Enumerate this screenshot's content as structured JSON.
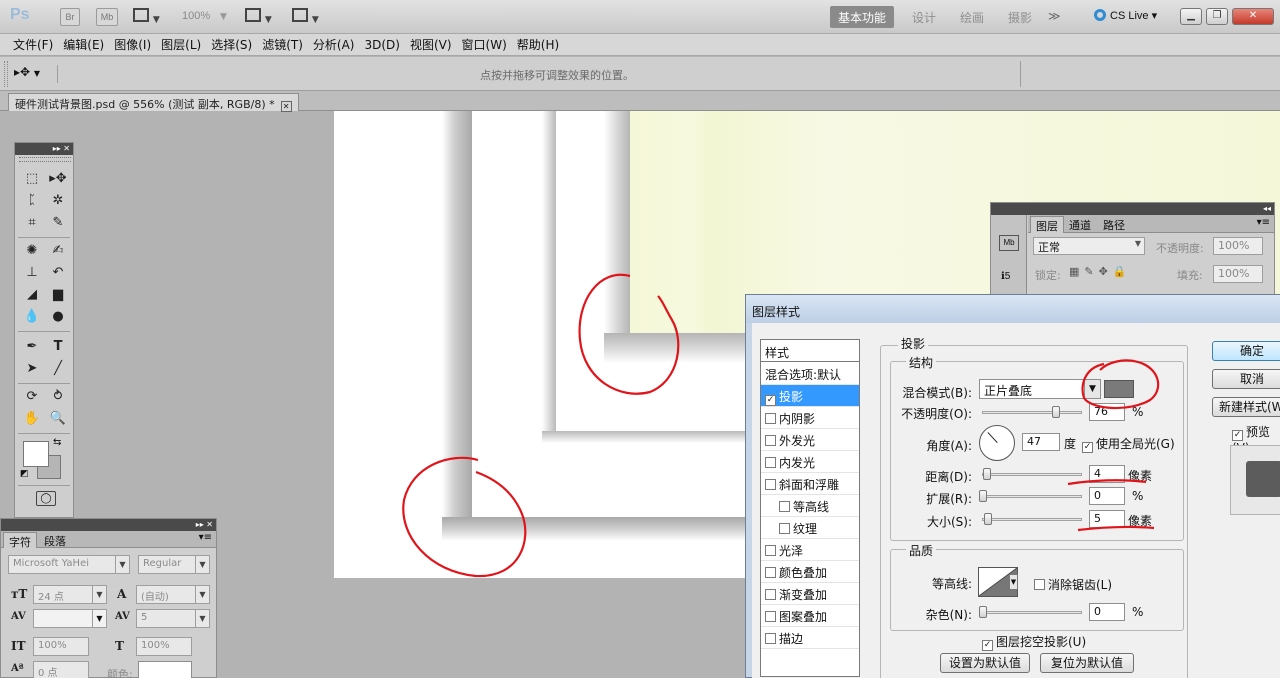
{
  "appbar": {
    "logo": "Ps",
    "br": "Br",
    "mb": "Mb",
    "zoom": "100%",
    "workspaces": [
      "基本功能",
      "设计",
      "绘画",
      "摄影"
    ],
    "more": "≫",
    "cslive": "CS Live",
    "colors": {
      "accent": "#2f8bd2",
      "close": "#c43b2a"
    }
  },
  "menubar": {
    "items": [
      "文件(F)",
      "编辑(E)",
      "图像(I)",
      "图层(L)",
      "选择(S)",
      "滤镜(T)",
      "分析(A)",
      "3D(D)",
      "视图(V)",
      "窗口(W)",
      "帮助(H)"
    ]
  },
  "options": {
    "hint": "点按并拖移可调整效果的位置。"
  },
  "document": {
    "tab_title": "硬件测试背景图.psd @ 556% (测试 副本, RGB/8) *"
  },
  "tools": {
    "icons": [
      "marquee-icon",
      "move-icon",
      "lasso-icon",
      "magic-wand-icon",
      "crop-icon",
      "eyedropper-icon",
      "healing-brush-icon",
      "brush-icon",
      "stamp-icon",
      "history-brush-icon",
      "eraser-icon",
      "gradient-icon",
      "blur-icon",
      "dodge-icon",
      "pen-icon",
      "type-icon",
      "path-select-icon",
      "line-icon",
      "3d-rotate-icon",
      "3d-orbit-icon",
      "hand-icon",
      "zoom-icon"
    ]
  },
  "character": {
    "tabs": [
      "字符",
      "段落"
    ],
    "font": "Microsoft YaHei",
    "style": "Regular",
    "size": "24 点",
    "leading": "(自动)",
    "kerning": "",
    "tracking": "5",
    "vscale": "100%",
    "hscale": "100%",
    "baseline": "0 点",
    "color_label": "颜色:"
  },
  "layers": {
    "tabs": [
      "图层",
      "通道",
      "路径"
    ],
    "blend": "正常",
    "opacity_label": "不透明度:",
    "opacity": "100%",
    "lock_label": "锁定:",
    "fill_label": "填充:",
    "fill": "100%"
  },
  "dialog": {
    "title": "图层样式",
    "styles_header": "样式",
    "style_items": [
      {
        "label": "混合选项:默认",
        "checkbox": false,
        "checked": false,
        "selected": false
      },
      {
        "label": "投影",
        "checkbox": true,
        "checked": true,
        "selected": true
      },
      {
        "label": "内阴影",
        "checkbox": true,
        "checked": false,
        "selected": false
      },
      {
        "label": "外发光",
        "checkbox": true,
        "checked": false,
        "selected": false
      },
      {
        "label": "内发光",
        "checkbox": true,
        "checked": false,
        "selected": false
      },
      {
        "label": "斜面和浮雕",
        "checkbox": true,
        "checked": false,
        "selected": false
      },
      {
        "label": "等高线",
        "checkbox": true,
        "checked": false,
        "selected": false
      },
      {
        "label": "纹理",
        "checkbox": true,
        "checked": false,
        "selected": false
      },
      {
        "label": "光泽",
        "checkbox": true,
        "checked": false,
        "selected": false
      },
      {
        "label": "颜色叠加",
        "checkbox": true,
        "checked": false,
        "selected": false
      },
      {
        "label": "渐变叠加",
        "checkbox": true,
        "checked": false,
        "selected": false
      },
      {
        "label": "图案叠加",
        "checkbox": true,
        "checked": false,
        "selected": false
      },
      {
        "label": "描边",
        "checkbox": true,
        "checked": false,
        "selected": false
      }
    ],
    "section": "投影",
    "structure": "结构",
    "blend_label": "混合模式(B):",
    "blend_value": "正片叠底",
    "shadow_color": "#7a7a7a",
    "opacity_label": "不透明度(O):",
    "opacity": "76",
    "opacity_fraction": 0.76,
    "angle_label": "角度(A):",
    "angle": "47",
    "angle_unit": "度",
    "global_light": "使用全局光(G)",
    "distance_label": "距离(D):",
    "distance": "4",
    "spread_label": "扩展(R):",
    "spread": "0",
    "size_label": "大小(S):",
    "size": "5",
    "pixels": "像素",
    "percent": "%",
    "quality": "品质",
    "contour_label": "等高线:",
    "antialias": "消除锯齿(L)",
    "noise_label": "杂色(N):",
    "noise": "0",
    "knockout": "图层挖空投影(U)",
    "set_default": "设置为默认值",
    "reset_default": "复位为默认值",
    "ok": "确定",
    "cancel": "取消",
    "new_style": "新建样式(W)...",
    "preview": "预览(V)"
  }
}
